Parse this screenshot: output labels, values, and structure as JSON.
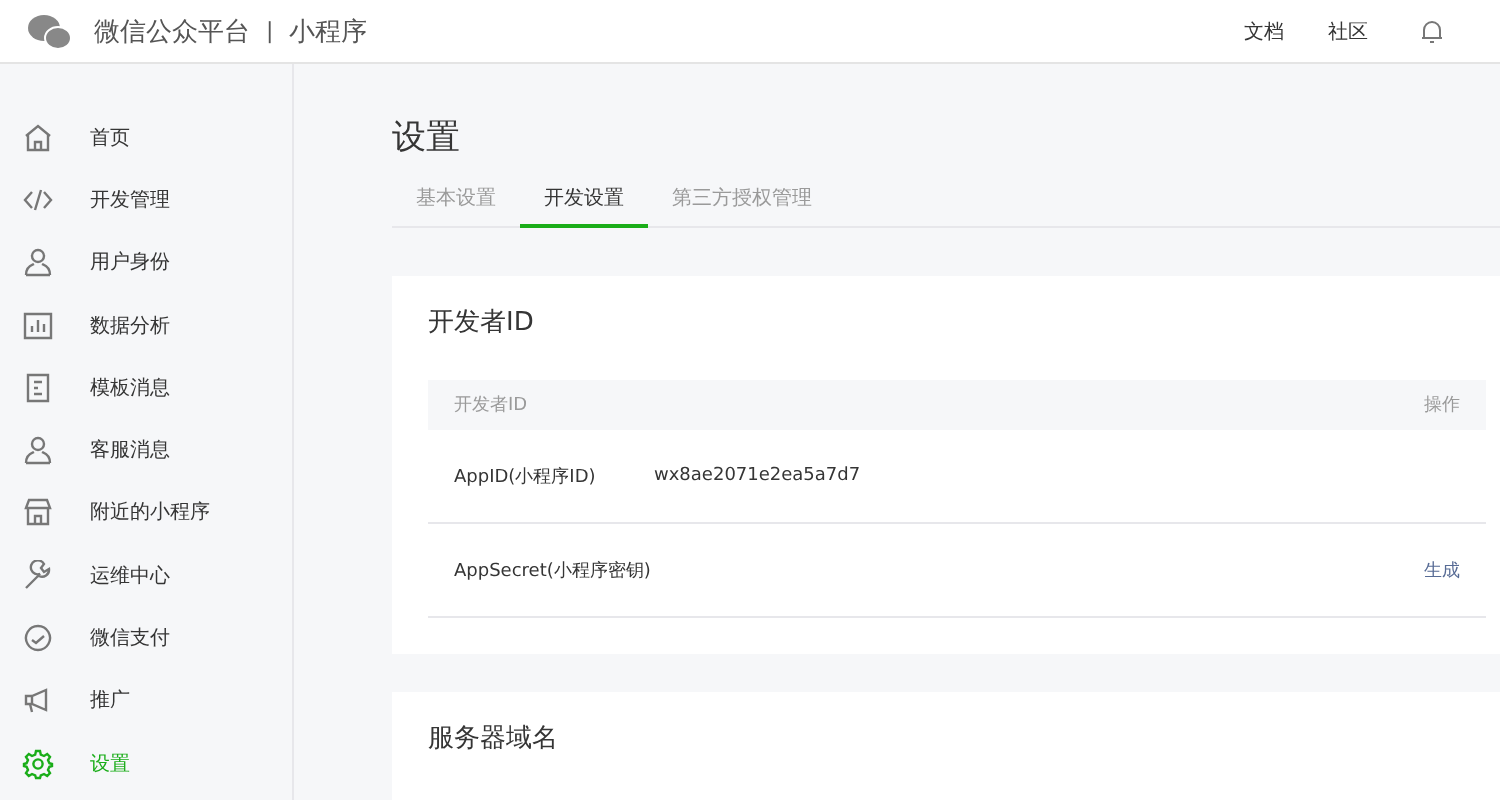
{
  "header": {
    "brand": "微信公众平台",
    "divider": "|",
    "product": "小程序",
    "links": [
      "文档",
      "社区"
    ]
  },
  "sidebar": {
    "items": [
      {
        "label": "首页",
        "kind": "home",
        "selected": false
      },
      {
        "label": "开发管理",
        "kind": "code",
        "selected": false
      },
      {
        "label": "用户身份",
        "kind": "user",
        "selected": false
      },
      {
        "label": "数据分析",
        "kind": "chart",
        "selected": false
      },
      {
        "label": "模板消息",
        "kind": "doc",
        "selected": false
      },
      {
        "label": "客服消息",
        "kind": "user",
        "selected": false
      },
      {
        "label": "附近的小程序",
        "kind": "store",
        "selected": false
      },
      {
        "label": "运维中心",
        "kind": "wrench",
        "selected": false
      },
      {
        "label": "微信支付",
        "kind": "pay",
        "selected": false
      },
      {
        "label": "推广",
        "kind": "megaphone",
        "selected": false
      },
      {
        "label": "设置",
        "kind": "gear",
        "selected": true
      }
    ]
  },
  "page_title": "设置",
  "tabs": [
    {
      "label": "基本设置",
      "selected": false
    },
    {
      "label": "开发设置",
      "selected": true
    },
    {
      "label": "第三方授权管理",
      "selected": false
    }
  ],
  "cards": [
    {
      "title": "开发者ID",
      "table": {
        "columns": [
          "开发者ID",
          "操作"
        ],
        "rows": [
          {
            "name": "AppID(小程序ID)",
            "value": "wx8ae2071e2ea5a7d7"
          },
          {
            "name": "AppSecret(小程序密钥)",
            "action": "生成"
          }
        ]
      }
    },
    {
      "title": "服务器域名"
    }
  ]
}
